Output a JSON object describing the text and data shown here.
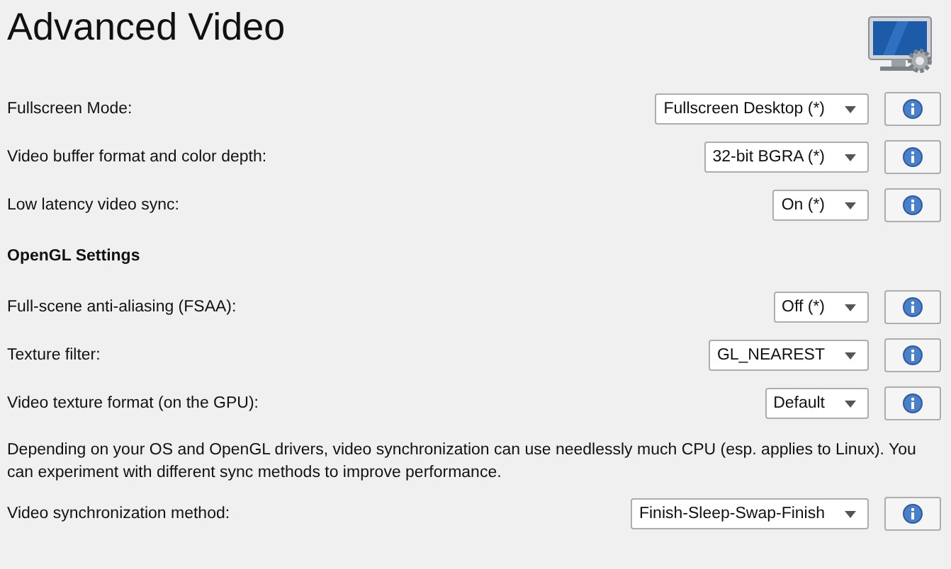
{
  "title": "Advanced Video",
  "rows": [
    {
      "kind": "setting",
      "label": "Fullscreen Mode:",
      "value": "Fullscreen Desktop (*)"
    },
    {
      "kind": "setting",
      "label": "Video buffer format and color depth:",
      "value": "32-bit BGRA (*)"
    },
    {
      "kind": "setting",
      "label": "Low latency video sync:",
      "value": "On (*)"
    },
    {
      "kind": "heading",
      "label": "OpenGL Settings"
    },
    {
      "kind": "setting",
      "label": "Full-scene anti-aliasing (FSAA):",
      "value": "Off (*)"
    },
    {
      "kind": "setting",
      "label": "Texture filter:",
      "value": "GL_NEAREST"
    },
    {
      "kind": "setting",
      "label": "Video texture format (on the GPU):",
      "value": "Default"
    },
    {
      "kind": "note",
      "label": "Depending on your OS and OpenGL drivers, video synchronization can use needlessly much CPU (esp. applies to Linux). You can experiment with different sync methods to improve performance."
    },
    {
      "kind": "setting",
      "label": "Video synchronization method:",
      "value": "Finish-Sleep-Swap-Finish"
    }
  ]
}
